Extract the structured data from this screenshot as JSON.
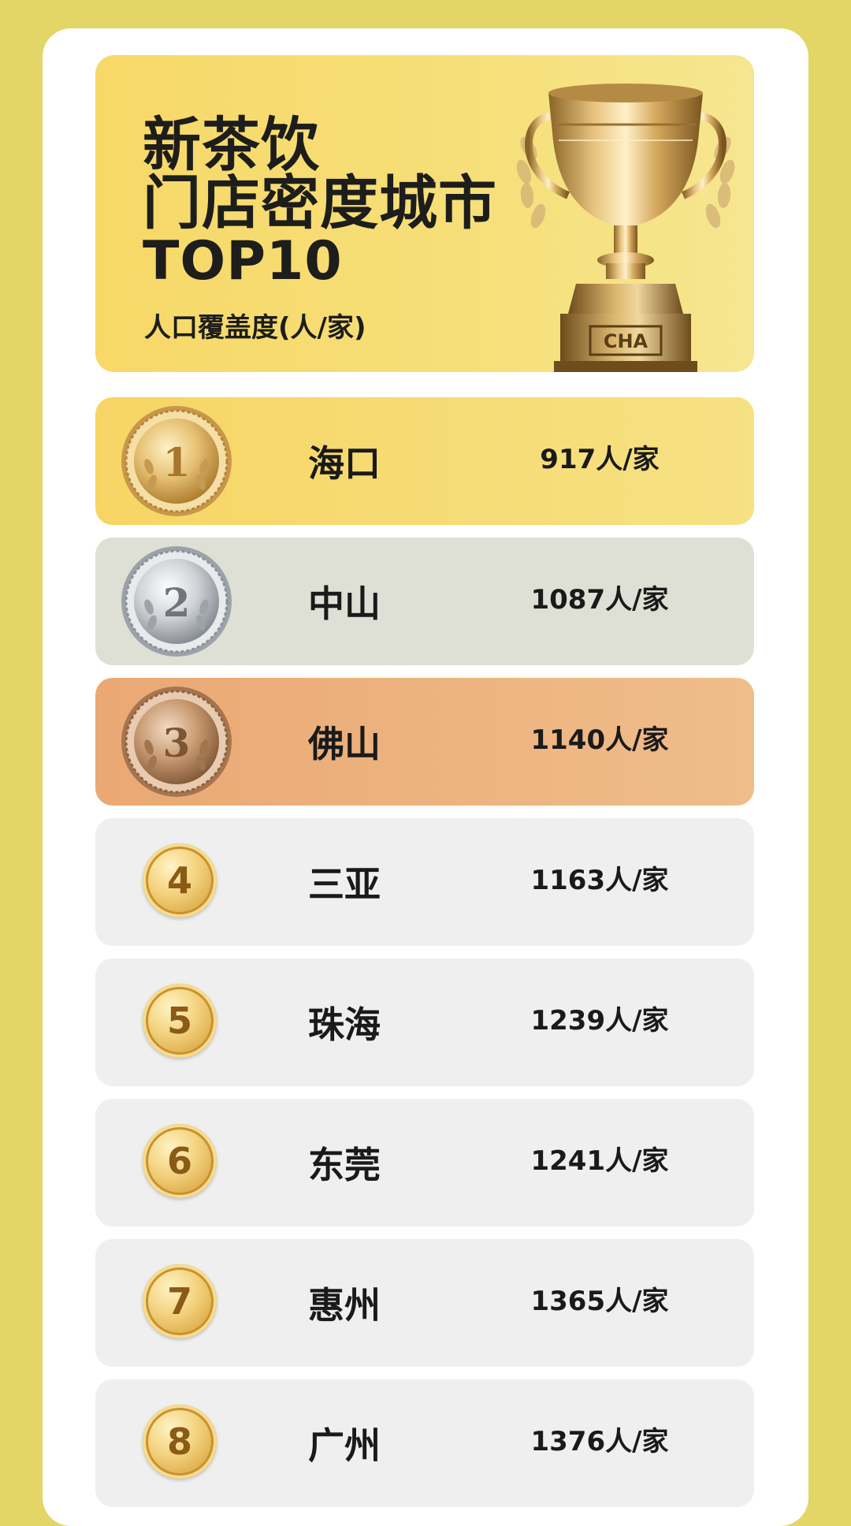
{
  "header": {
    "title_line1": "新茶饮",
    "title_line2": "门店密度城市",
    "title_line3": "TOP10",
    "subtitle": "人口覆盖度(人/家)",
    "trophy_label": "CHA"
  },
  "rankings": [
    {
      "rank": "1",
      "city": "海口",
      "value": "917人/家"
    },
    {
      "rank": "2",
      "city": "中山",
      "value": "1087人/家"
    },
    {
      "rank": "3",
      "city": "佛山",
      "value": "1140人/家"
    },
    {
      "rank": "4",
      "city": "三亚",
      "value": "1163人/家"
    },
    {
      "rank": "5",
      "city": "珠海",
      "value": "1239人/家"
    },
    {
      "rank": "6",
      "city": "东莞",
      "value": "1241人/家"
    },
    {
      "rank": "7",
      "city": "惠州",
      "value": "1365人/家"
    },
    {
      "rank": "8",
      "city": "广州",
      "value": "1376人/家"
    }
  ],
  "colors": {
    "background": "#e3d566",
    "gold_row": "#f7d565",
    "silver_row": "#dfe0d5",
    "bronze_row": "#eaa874",
    "plain_row": "#efefef"
  }
}
